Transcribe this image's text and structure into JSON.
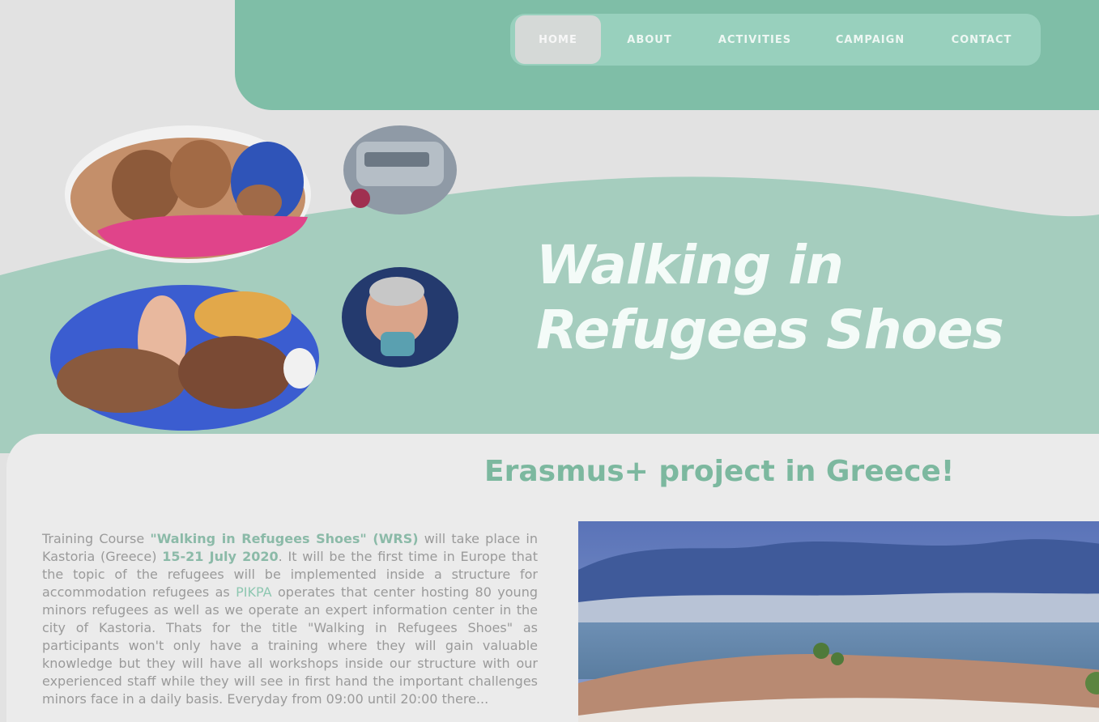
{
  "nav": {
    "items": [
      {
        "label": "HOME",
        "active": true
      },
      {
        "label": "ABOUT",
        "active": false
      },
      {
        "label": "ACTIVITIES",
        "active": false
      },
      {
        "label": "CAMPAIGN",
        "active": false
      },
      {
        "label": "CONTACT",
        "active": false
      }
    ]
  },
  "hero": {
    "title_line1": "Walking in",
    "title_line2": "Refugees Shoes"
  },
  "section": {
    "heading": "Erasmus+ project in Greece!",
    "paragraph": {
      "p1": "Training Course ",
      "name": "\"Walking in Refugees Shoes\" (WRS)",
      "p2": " will take place in Kastoria (Greece) ",
      "dates": "15-21 July 2020",
      "p3": ". It will be the first time in Europe that the topic of the refugees will be implemented inside a structure for accommodation refugees as ",
      "org": "PIKPA",
      "p4": " operates that center hosting 80 young minors refugees as well as we operate an expert information center in the city of Kastoria. Thats for the title \"Walking in Refugees Shoes\" as participants won't only have a training where they will gain valuable knowledge but they will have all workshops inside our structure with our experienced staff while they will see in first hand the important challenges minors face in a daily basis. Everyday from 09:00 until 20:00 there..."
    }
  },
  "colors": {
    "header_green": "#7fbea7",
    "nav_pill": "#98d0bd",
    "hero_wave": "#a5cdbe",
    "heading_green": "#7cb89f",
    "page_bg": "#e2e2e2"
  }
}
